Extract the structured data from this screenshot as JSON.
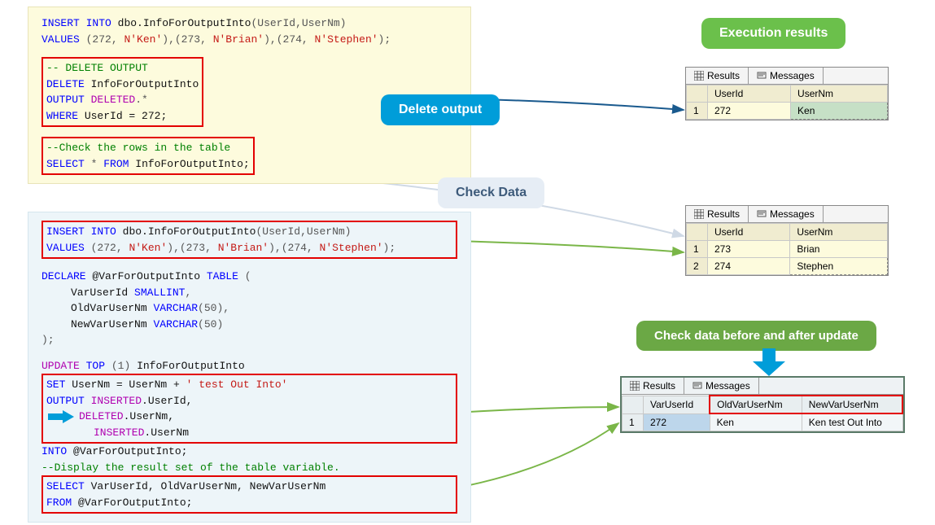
{
  "codeYellow": {
    "line1_a": "INSERT INTO",
    "line1_b": "dbo.InfoForOutputInto",
    "line1_c": "(UserId,UserNm)",
    "line2_a": "VALUES",
    "line2_b": "(272,",
    "line2_c": "N'Ken'",
    "line2_d": "),(273,",
    "line2_e": "N'Brian'",
    "line2_f": "),(274,",
    "line2_g": "N'Stephen'",
    "line2_h": ");",
    "del_comment": "-- DELETE OUTPUT",
    "del_a": "DELETE",
    "del_b": "InfoForOutputInto",
    "out_a": "OUTPUT",
    "out_b": "DELETED",
    "out_c": ".*",
    "where_a": "WHERE",
    "where_b": "UserId = 272;",
    "chk_comment": "--Check the rows in the table",
    "sel_a": "SELECT",
    "sel_b": "*",
    "sel_c": "FROM",
    "sel_d": "InfoForOutputInto;"
  },
  "codeBlue": {
    "ins1_a": "INSERT INTO",
    "ins1_b": "dbo.InfoForOutputInto",
    "ins1_c": "(UserId,UserNm)",
    "ins2_a": "VALUES",
    "ins2_b": "(272,",
    "ins2_c": "N'Ken'",
    "ins2_d": "),(273,",
    "ins2_e": "N'Brian'",
    "ins2_f": "),(274,",
    "ins2_g": "N'Stephen'",
    "ins2_h": ");",
    "decl_a": "DECLARE",
    "decl_b": "@VarForOutputInto",
    "decl_c": "TABLE",
    "decl_d": "(",
    "f1_a": "VarUserId",
    "f1_b": "SMALLINT",
    "f1_c": ",",
    "f2_a": "OldVarUserNm",
    "f2_b": "VARCHAR",
    "f2_c": "(50),",
    "f3_a": "NewVarUserNm",
    "f3_b": "VARCHAR",
    "f3_c": "(50)",
    "close_p": ");",
    "upd_a": "UPDATE",
    "upd_b": "TOP",
    "upd_c": "(1)",
    "upd_d": "InfoForOutputInto",
    "set_a": "SET",
    "set_b": "UserNm = UserNm +",
    "set_c": "' test Out Into'",
    "out2_a": "OUTPUT",
    "out2_b": "INSERTED",
    "out2_c": ".UserId,",
    "out3_a": "DELETED",
    "out3_b": ".UserNm,",
    "out4_a": "INSERTED",
    "out4_b": ".UserNm",
    "into_a": "INTO",
    "into_b": "@VarForOutputInto;",
    "disp_comment": "--Display the result set of the table variable.",
    "sel2_a": "SELECT",
    "sel2_b": "VarUserId, OldVarUserNm, NewVarUserNm",
    "from_a": "FROM",
    "from_b": "@VarForOutputInto;"
  },
  "labels": {
    "execResults": "Execution results",
    "deleteOutput": "Delete output",
    "checkData": "Check Data",
    "checkBeforeAfter": "Check data before and after update",
    "tabResults": "Results",
    "tabMessages": "Messages"
  },
  "grid1": {
    "headers": [
      "UserId",
      "UserNm"
    ],
    "rows": [
      [
        "1",
        "272",
        "Ken"
      ]
    ]
  },
  "grid2": {
    "headers": [
      "UserId",
      "UserNm"
    ],
    "rows": [
      [
        "1",
        "273",
        "Brian"
      ],
      [
        "2",
        "274",
        "Stephen"
      ]
    ]
  },
  "grid3": {
    "headers": [
      "VarUserId",
      "OldVarUserNm",
      "NewVarUserNm"
    ],
    "rows": [
      [
        "1",
        "272",
        "Ken",
        "Ken test Out Into"
      ]
    ]
  }
}
